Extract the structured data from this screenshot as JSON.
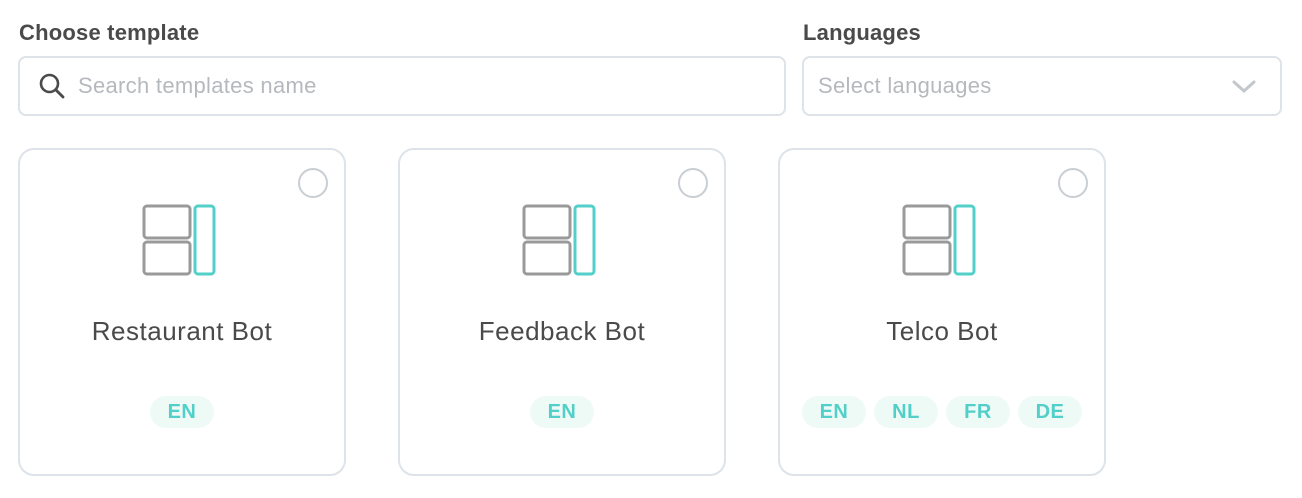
{
  "template_field": {
    "label": "Choose template",
    "placeholder": "Search templates name",
    "value": ""
  },
  "languages_field": {
    "label": "Languages",
    "placeholder": "Select languages"
  },
  "cards": [
    {
      "title": "Restaurant Bot",
      "languages": [
        "EN"
      ],
      "selected": false
    },
    {
      "title": "Feedback Bot",
      "languages": [
        "EN"
      ],
      "selected": false
    },
    {
      "title": "Telco Bot",
      "languages": [
        "EN",
        "NL",
        "FR",
        "DE"
      ],
      "selected": false
    }
  ],
  "colors": {
    "accent": "#52cfc9",
    "badge_bg": "#eefaf6",
    "icon_gray": "#9a9a9a",
    "border": "#dde3e8"
  },
  "icons": {
    "search": "search-icon",
    "dropdown": "chevron-down-icon",
    "template": "layout-template-icon",
    "radio": "radio-button"
  }
}
